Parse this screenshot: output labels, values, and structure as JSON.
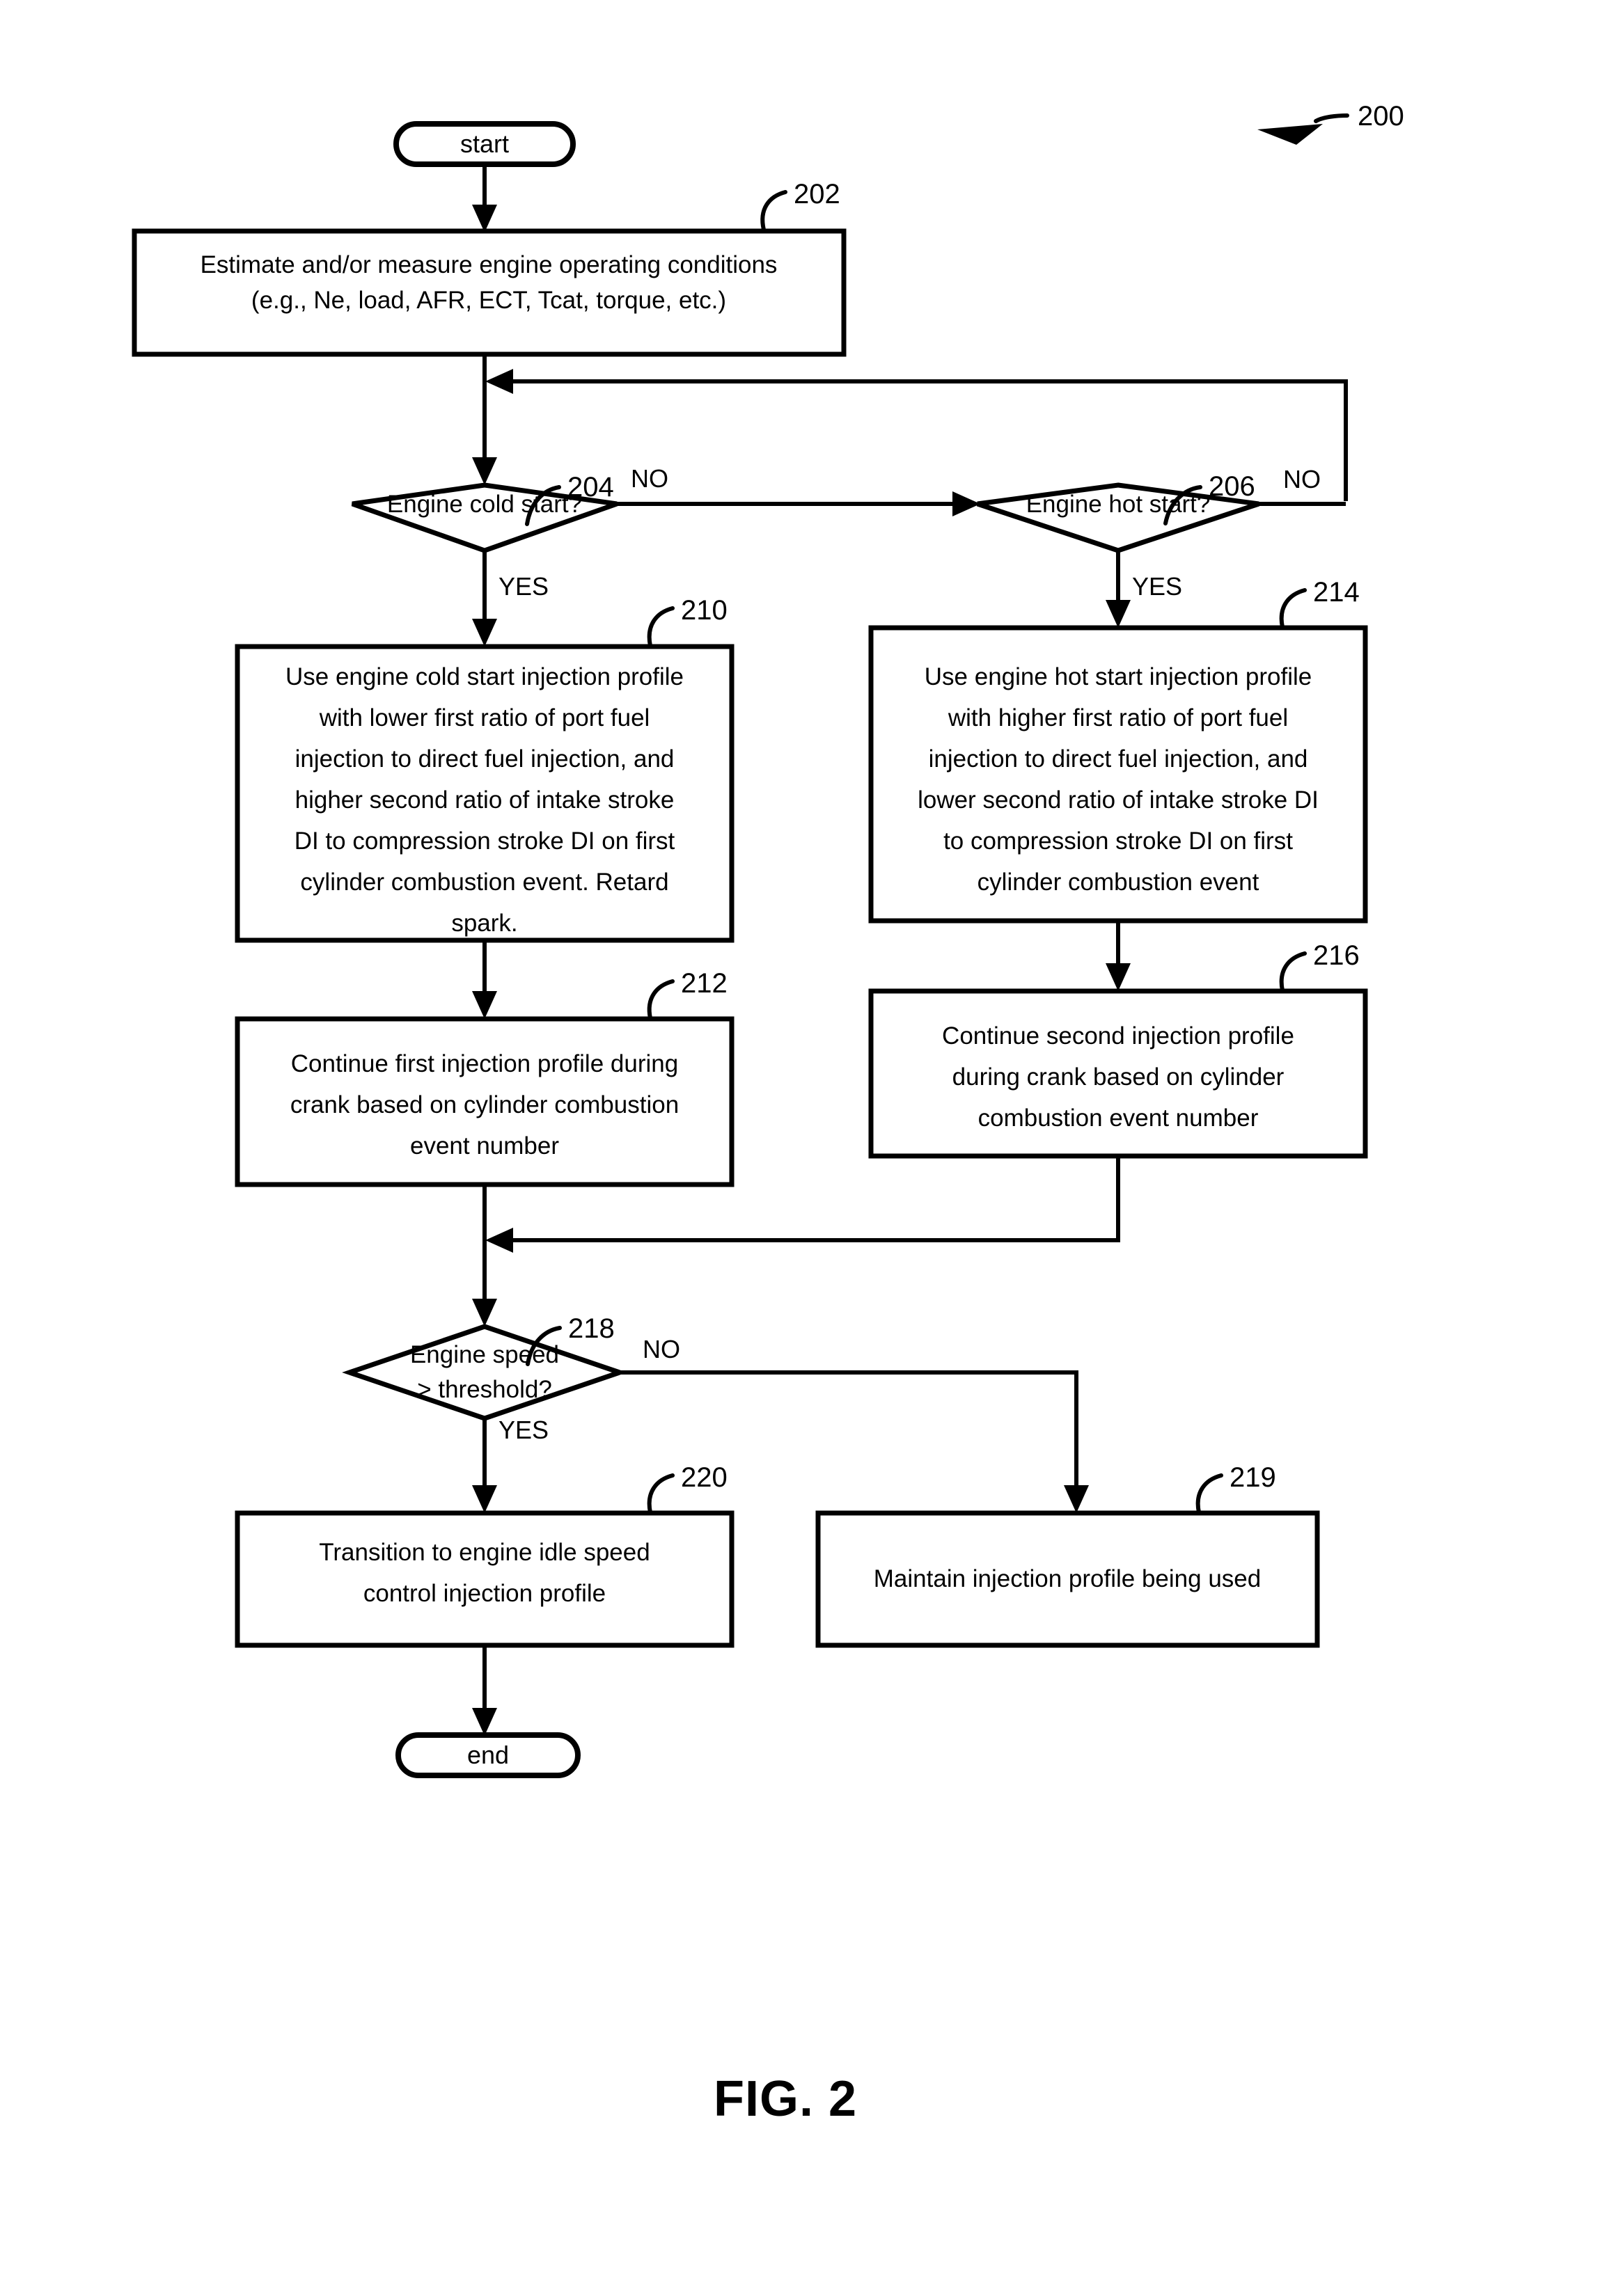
{
  "figure": {
    "caption": "FIG. 2",
    "reference_numeral": "200"
  },
  "nodes": {
    "start": {
      "ref": "",
      "label": "start",
      "type": "terminator"
    },
    "step_202": {
      "ref": "202",
      "type": "process",
      "lines": [
        "Estimate and/or measure engine operating conditions",
        "(e.g., Ne, load, AFR, ECT, Tcat, torque, etc.)"
      ]
    },
    "step_204": {
      "ref": "204",
      "type": "decision",
      "lines": [
        "Engine cold start?"
      ],
      "yes_label": "YES",
      "no_label": "NO"
    },
    "step_206": {
      "ref": "206",
      "type": "decision",
      "lines": [
        "Engine hot start?"
      ],
      "yes_label": "YES",
      "no_label": "NO"
    },
    "step_210": {
      "ref": "210",
      "type": "process",
      "lines": [
        "Use engine cold start injection profile",
        "with lower first ratio of port fuel",
        "injection to direct fuel injection, and",
        "higher second ratio of intake stroke",
        "DI to compression stroke DI on first",
        "cylinder combustion event. Retard",
        "spark."
      ]
    },
    "step_214": {
      "ref": "214",
      "type": "process",
      "lines": [
        "Use engine hot start injection profile",
        "with higher first ratio of port fuel",
        "injection to direct fuel injection, and",
        "lower second ratio of intake stroke DI",
        "to compression stroke DI on first",
        "cylinder combustion event"
      ]
    },
    "step_212": {
      "ref": "212",
      "type": "process",
      "lines": [
        "Continue first injection profile during",
        "crank based on cylinder combustion",
        "event number"
      ]
    },
    "step_216": {
      "ref": "216",
      "type": "process",
      "lines": [
        "Continue second injection profile",
        "during crank based on cylinder",
        "combustion event number"
      ]
    },
    "step_218": {
      "ref": "218",
      "type": "decision",
      "lines": [
        "Engine speed",
        "> threshold?"
      ],
      "yes_label": "YES",
      "no_label": "NO"
    },
    "step_220": {
      "ref": "220",
      "type": "process",
      "lines": [
        "Transition to engine idle speed",
        "control injection profile"
      ]
    },
    "step_219": {
      "ref": "219",
      "type": "process",
      "lines": [
        "Maintain injection profile being used"
      ]
    },
    "end": {
      "ref": "",
      "label": "end",
      "type": "terminator"
    }
  },
  "colors": {
    "line": "#000000",
    "fill": "#ffffff",
    "text": "#000000"
  }
}
